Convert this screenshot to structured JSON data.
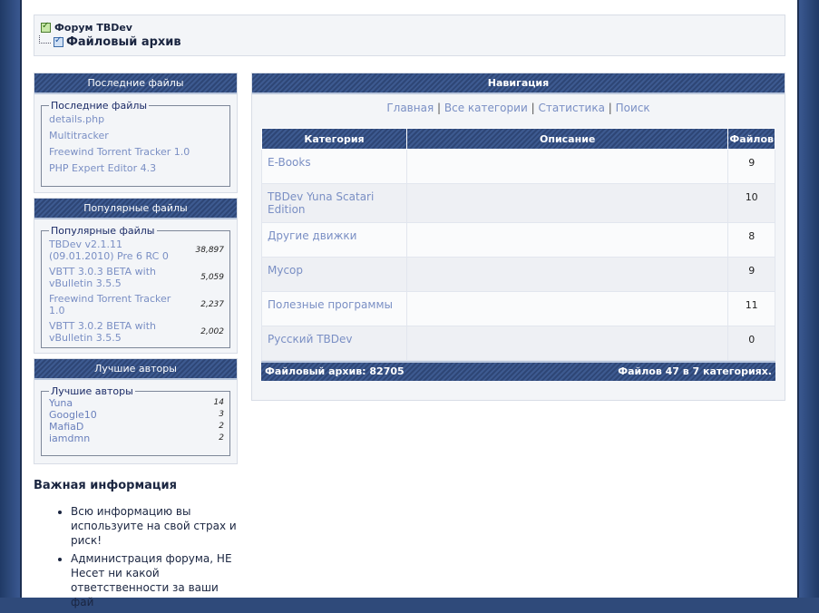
{
  "breadcrumb": {
    "root": "Форум TBDev",
    "current": "Файловый архив"
  },
  "sidebar": {
    "latest": {
      "header": "Последние файлы",
      "legend": "Последние файлы",
      "items": [
        "details.php",
        "Multitracker",
        "Freewind Torrent Tracker 1.0",
        "PHP Expert Editor 4.3"
      ]
    },
    "popular": {
      "header": "Популярные файлы",
      "legend": "Популярные файлы",
      "items": [
        {
          "name": "TBDev v2.1.11 (09.01.2010) Pre 6 RC 0",
          "count": "38,897"
        },
        {
          "name": "VBTT 3.0.3 BETA with vBulletin 3.5.5",
          "count": "5,059"
        },
        {
          "name": "Freewind Torrent Tracker 1.0",
          "count": "2,237"
        },
        {
          "name": "VBTT 3.0.2 BETA with vBulletin 3.5.5",
          "count": "2,002"
        }
      ]
    },
    "authors": {
      "header": "Лучшие авторы",
      "legend": "Лучшие авторы",
      "items": [
        {
          "name": "Yuna",
          "count": "14"
        },
        {
          "name": "Google10",
          "count": "3"
        },
        {
          "name": "MafiaD",
          "count": "2"
        },
        {
          "name": "iamdmn",
          "count": "2"
        }
      ]
    }
  },
  "important": {
    "title": "Важная информация",
    "items": [
      "Всю информацию вы используите на свой страх и риск!",
      "Администрация форума, НЕ Несет ни какой ответственности за ваши фай"
    ]
  },
  "main": {
    "header": "Навигация",
    "links": [
      "Главная",
      "Все категории",
      "Статистика",
      "Поиск"
    ],
    "separator": "|",
    "columns": [
      "Категория",
      "Описание",
      "Файлов"
    ],
    "rows": [
      {
        "category": "E-Books",
        "description": "",
        "files": "9"
      },
      {
        "category": "TBDev Yuna Scatari Edition",
        "description": "",
        "files": "10"
      },
      {
        "category": "Другие движки",
        "description": "",
        "files": "8"
      },
      {
        "category": "Мусор",
        "description": "",
        "files": "9"
      },
      {
        "category": "Полезные программы",
        "description": "",
        "files": "11"
      },
      {
        "category": "Русский TBDev",
        "description": "",
        "files": "0"
      }
    ],
    "footer_left": "Файловый архив: 82705",
    "footer_right": "Файлов 47 в 7 категориях."
  }
}
